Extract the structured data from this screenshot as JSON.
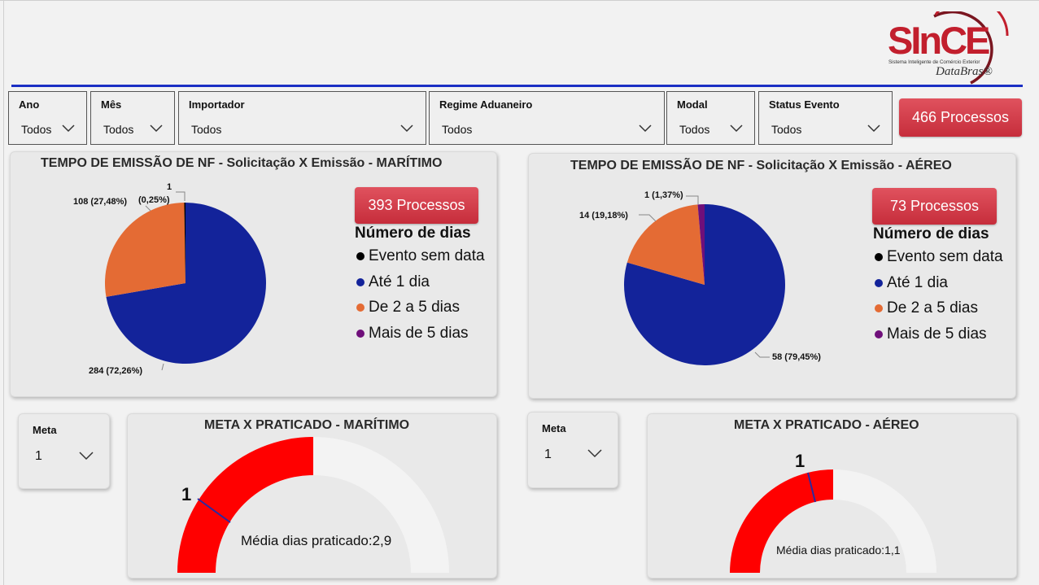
{
  "logo": {
    "brand": "SInCE",
    "subtitle": "Sistema Inteligente de Comércio Exterior",
    "partner": "DataBras®"
  },
  "filters": [
    {
      "label": "Ano",
      "value": "Todos"
    },
    {
      "label": "Mês",
      "value": "Todos"
    },
    {
      "label": "Importador",
      "value": "Todos"
    },
    {
      "label": "Regime Aduaneiro",
      "value": "Todos"
    },
    {
      "label": "Modal",
      "value": "Todos"
    },
    {
      "label": "Status Evento",
      "value": "Todos"
    }
  ],
  "total_button": "466 Processos",
  "legend": {
    "title": "Número de dias",
    "items": [
      {
        "label": "Evento sem data",
        "color": "#000000"
      },
      {
        "label": "Até 1 dia",
        "color": "#13239a"
      },
      {
        "label": "De 2 a 5 dias",
        "color": "#e46b34"
      },
      {
        "label": "Mais de 5 dias",
        "color": "#6f0f7a"
      }
    ]
  },
  "maritimo": {
    "title": "TEMPO DE EMISSÃO DE NF - Solicitação X Emissão - MARÍTIMO",
    "processos": "393 Processos",
    "labels": {
      "a": "1",
      "a2": "(0,25%)",
      "b": "108 (27,48%)",
      "c": "284 (72,26%)"
    },
    "meta_label": "Meta",
    "meta_value": "1",
    "gauge_title": "META X PRATICADO - MARÍTIMO",
    "gauge_target_label": "1",
    "gauge_text": "Média dias praticado:2,9"
  },
  "aereo": {
    "title": "TEMPO DE EMISSÃO DE NF - Solicitação X Emissão - AÉREO",
    "processos": "73 Processos",
    "labels": {
      "a": "1 (1,37%)",
      "b": "14 (19,18%)",
      "c": "58 (79,45%)"
    },
    "meta_label": "Meta",
    "meta_value": "1",
    "gauge_title": "META X PRATICADO - AÉREO",
    "gauge_target_label": "1",
    "gauge_text": "Média dias praticado:1,1"
  },
  "chart_data": [
    {
      "type": "pie",
      "title": "TEMPO DE EMISSÃO DE NF - Solicitação X Emissão - MARÍTIMO",
      "categories": [
        "Evento sem data",
        "Até 1 dia",
        "De 2 a 5 dias",
        "Mais de 5 dias"
      ],
      "values": [
        1,
        284,
        108,
        0
      ],
      "percent": [
        0.25,
        72.26,
        27.48,
        0
      ],
      "legend_position": "right"
    },
    {
      "type": "pie",
      "title": "TEMPO DE EMISSÃO DE NF - Solicitação X Emissão - AÉREO",
      "categories": [
        "Evento sem data",
        "Até 1 dia",
        "De 2 a 5 dias",
        "Mais de 5 dias"
      ],
      "values": [
        0,
        58,
        14,
        1
      ],
      "percent": [
        0,
        79.45,
        19.18,
        1.37
      ],
      "legend_position": "right"
    }
  ]
}
